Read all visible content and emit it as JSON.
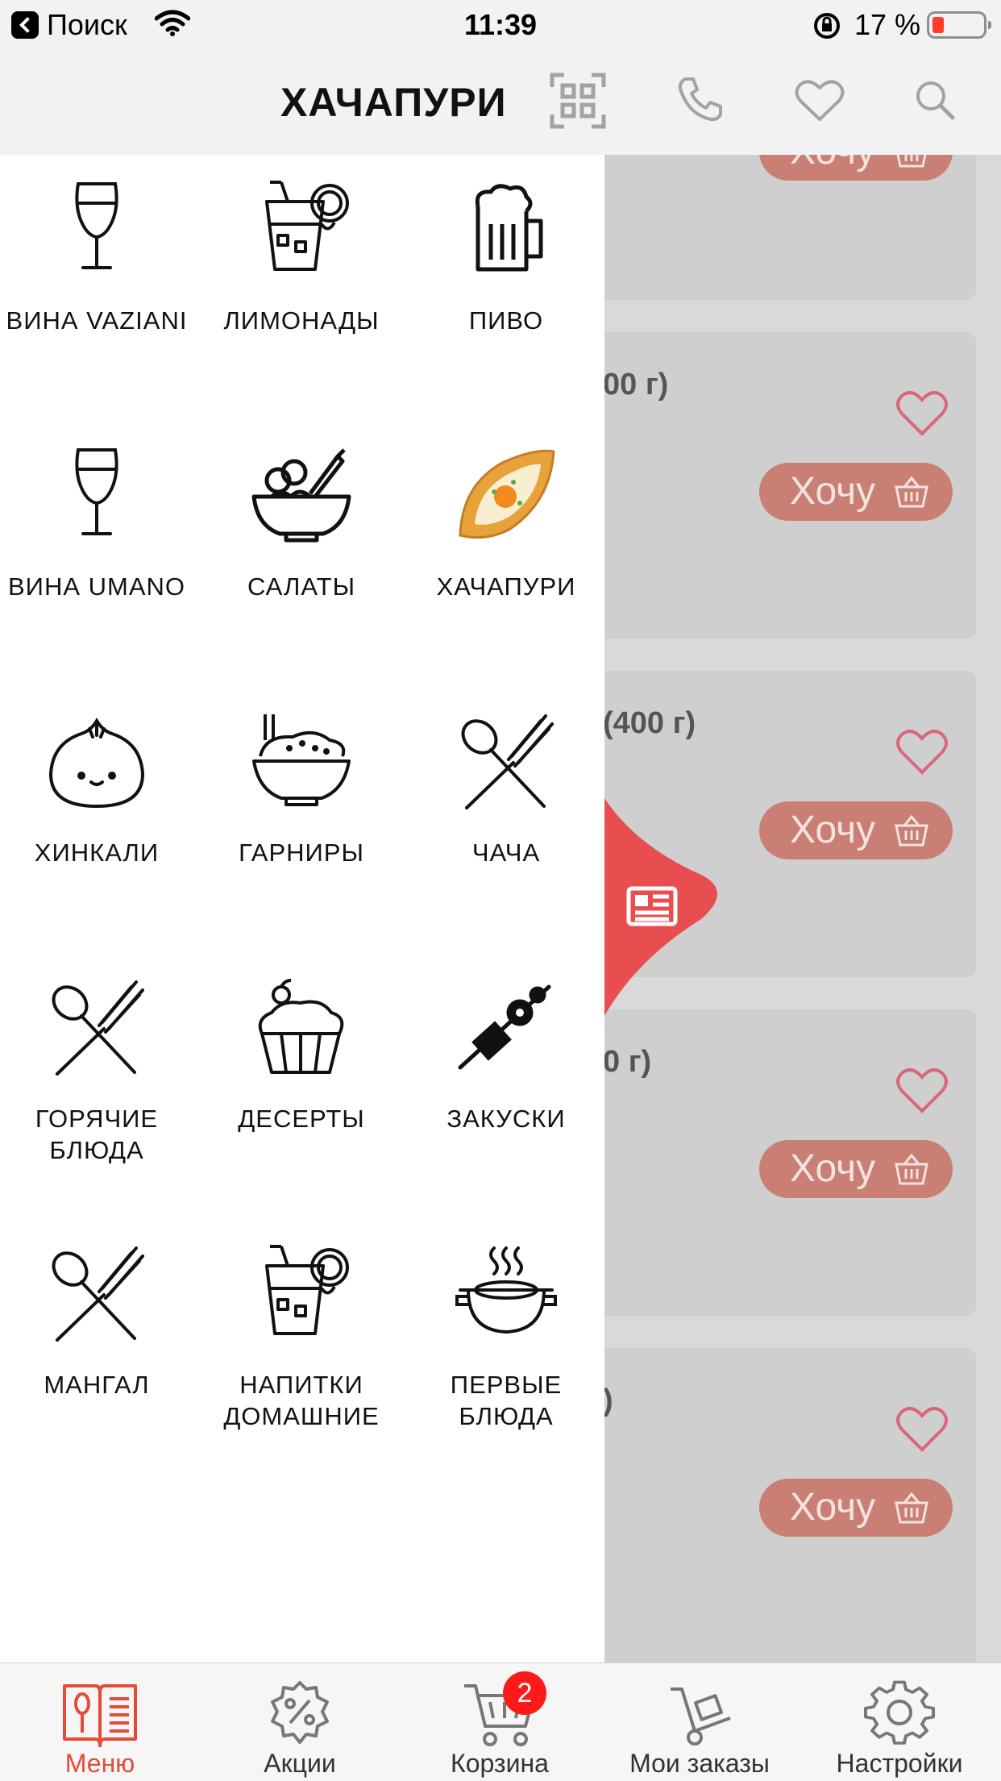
{
  "status_bar": {
    "back_label": "Поиск",
    "time": "11:39",
    "battery_percent": "17 %",
    "battery_level": 0.17
  },
  "header": {
    "title": "ХАЧАПУРИ",
    "icons": [
      "qr-code-icon",
      "phone-icon",
      "heart-icon",
      "search-icon"
    ]
  },
  "drawer": {
    "categories": [
      {
        "label": "ВИНА VAZIANI",
        "icon": "wine-glass-icon"
      },
      {
        "label": "ЛИМОНАДЫ",
        "icon": "lemonade-icon"
      },
      {
        "label": "ПИВО",
        "icon": "beer-mug-icon"
      },
      {
        "label": "ВИНА UMANO",
        "icon": "wine-glass-icon"
      },
      {
        "label": "САЛАТЫ",
        "icon": "salad-bowl-icon"
      },
      {
        "label": "ХАЧАПУРИ",
        "icon": "khachapuri-icon"
      },
      {
        "label": "ХИНКАЛИ",
        "icon": "khinkali-icon"
      },
      {
        "label": "ГАРНИРЫ",
        "icon": "rice-bowl-icon"
      },
      {
        "label": "ЧАЧА",
        "icon": "spoon-fork-icon"
      },
      {
        "label": "ГОРЯЧИЕ БЛЮДА",
        "icon": "spoon-fork-icon"
      },
      {
        "label": "ДЕСЕРТЫ",
        "icon": "cupcake-icon"
      },
      {
        "label": "ЗАКУСКИ",
        "icon": "skewer-icon"
      },
      {
        "label": "МАНГАЛ",
        "icon": "spoon-fork-icon"
      },
      {
        "label": "НАПИТКИ ДОМАШНИЕ",
        "icon": "lemonade-icon"
      },
      {
        "label": "ПЕРВЫЕ БЛЮДА",
        "icon": "soup-pot-icon"
      }
    ]
  },
  "list": {
    "cards": [
      {
        "name": "",
        "button": "Хочу"
      },
      {
        "name": "00 г)",
        "button": "Хочу"
      },
      {
        "name": "(400 г)",
        "button": "Хочу"
      },
      {
        "name": "0 г)",
        "button": "Хочу"
      },
      {
        "name": ")",
        "button": "Хочу"
      }
    ]
  },
  "tab_bar": {
    "tabs": [
      {
        "label": "Меню",
        "icon": "menu-book-icon",
        "active": true
      },
      {
        "label": "Акции",
        "icon": "discount-gear-icon"
      },
      {
        "label": "Корзина",
        "icon": "cart-icon"
      },
      {
        "label": "Мои заказы",
        "icon": "hand-truck-icon"
      },
      {
        "label": "Настройки",
        "icon": "settings-gear-icon"
      }
    ],
    "cart_badge": "2"
  },
  "colors": {
    "accent": "#e54b36",
    "button": "#c97f73",
    "heart": "#d9677c",
    "side_tab": "#e84d50"
  }
}
